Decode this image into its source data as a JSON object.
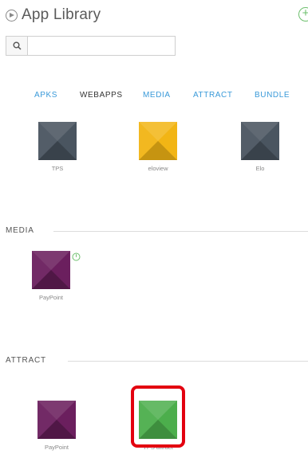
{
  "header": {
    "title": "App Library",
    "add_icon": "plus-circle-icon",
    "play_icon": "play-circle-icon"
  },
  "search": {
    "placeholder": "",
    "value": "",
    "icon": "search-icon"
  },
  "tabs": [
    {
      "label": "APKS",
      "active": false
    },
    {
      "label": "WEBAPPS",
      "active": true
    },
    {
      "label": "MEDIA",
      "active": false
    },
    {
      "label": "ATTRACT",
      "active": false
    },
    {
      "label": "BUNDLE",
      "active": false
    }
  ],
  "webapps": [
    {
      "label": "TPS",
      "color": "#4a5560"
    },
    {
      "label": "eloview",
      "color": "#f2b515"
    },
    {
      "label": "Elo",
      "color": "#4a5560"
    }
  ],
  "sections": {
    "media": {
      "label": "MEDIA",
      "apps": [
        {
          "label": "PayPoint",
          "color": "#6b1f5e"
        }
      ]
    },
    "attract": {
      "label": "ATTRACT",
      "apps": [
        {
          "label": "PayPoint",
          "color": "#6b1f5e"
        },
        {
          "label": "TPS attract",
          "color": "#4cae4c"
        }
      ]
    }
  },
  "colors": {
    "link": "#3a9ad9",
    "highlight": "#e3000f",
    "add": "#6cbf6c"
  }
}
